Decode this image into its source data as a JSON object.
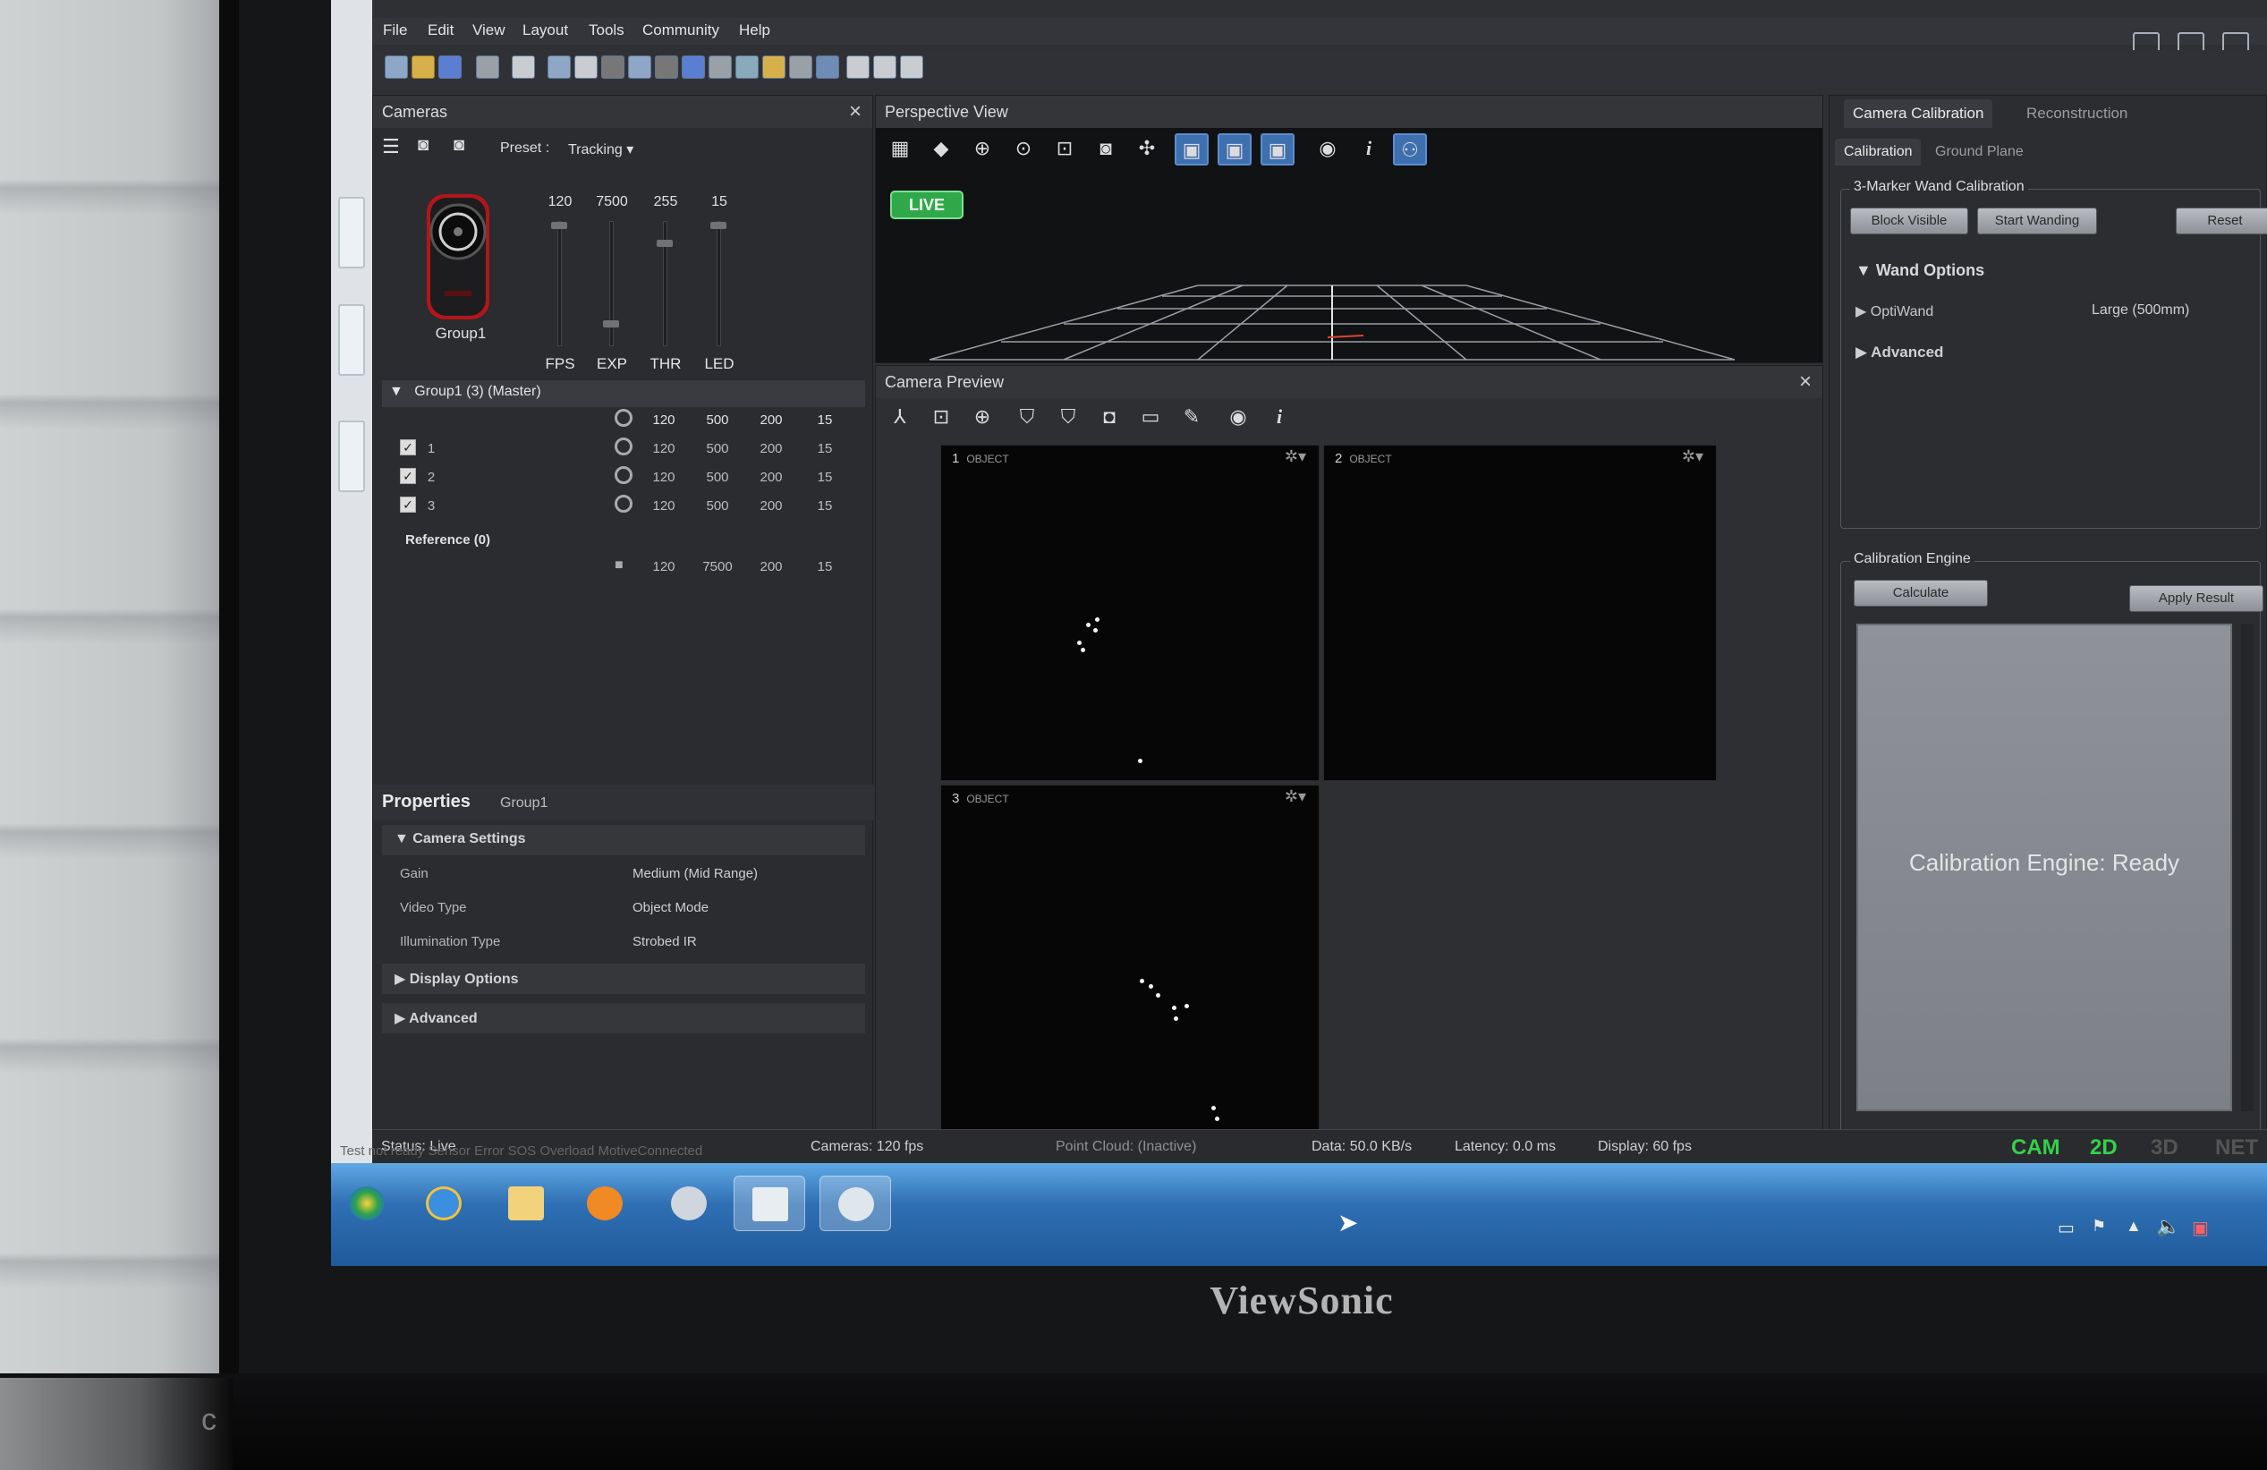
{
  "menu": [
    "File",
    "Edit",
    "View",
    "Layout",
    "Tools",
    "Community",
    "Help"
  ],
  "cameras": {
    "title": "Cameras",
    "preset_label": "Preset :",
    "preset_value": "Tracking",
    "camera_name": "Group1",
    "sliders": [
      {
        "label": "FPS",
        "value": "120"
      },
      {
        "label": "EXP",
        "value": "7500"
      },
      {
        "label": "THR",
        "value": "255"
      },
      {
        "label": "LED",
        "value": "15"
      }
    ],
    "group_row": {
      "label": "Group1 (3) (Master)",
      "fps": "120",
      "exp": "500",
      "thr": "200",
      "led": "15"
    },
    "rows": [
      {
        "id": "1",
        "fps": "120",
        "exp": "500",
        "thr": "200",
        "led": "15"
      },
      {
        "id": "2",
        "fps": "120",
        "exp": "500",
        "thr": "200",
        "led": "15"
      },
      {
        "id": "3",
        "fps": "120",
        "exp": "500",
        "thr": "200",
        "led": "15"
      }
    ],
    "reference": {
      "label": "Reference (0)",
      "fps": "120",
      "exp": "7500",
      "thr": "200",
      "led": "15"
    }
  },
  "properties": {
    "title": "Properties",
    "target": "Group1",
    "camera_settings": "Camera Settings",
    "rows": [
      {
        "name": "Gain",
        "value": "Medium (Mid Range)"
      },
      {
        "name": "Video Type",
        "value": "Object Mode"
      },
      {
        "name": "Illumination Type",
        "value": "Strobed IR"
      }
    ],
    "display_options": "Display Options",
    "advanced": "Advanced"
  },
  "perspective": {
    "title": "Perspective View",
    "live": "LIVE"
  },
  "preview": {
    "title": "Camera Preview",
    "viewports": [
      {
        "num": "1",
        "mode": "OBJECT"
      },
      {
        "num": "2",
        "mode": "OBJECT"
      },
      {
        "num": "3",
        "mode": "OBJECT"
      }
    ]
  },
  "right": {
    "tabs": [
      "Camera Calibration",
      "Reconstruction"
    ],
    "subtabs": [
      "Calibration",
      "Ground Plane"
    ],
    "wand_group": "3-Marker Wand Calibration",
    "buttons": {
      "block": "Block Visible",
      "start": "Start Wanding",
      "reset": "Reset",
      "calculate": "Calculate",
      "apply": "Apply Result"
    },
    "wand_options": "Wand Options",
    "optiwand": "OptiWand",
    "optiwand_value": "Large (500mm)",
    "advanced": "Advanced",
    "engine_group": "Calibration Engine",
    "engine_status": "Calibration Engine: Ready"
  },
  "status": {
    "status": "Status: Live",
    "cameras": "Cameras: 120 fps",
    "point_cloud": "Point Cloud: (Inactive)",
    "data": "Data: 50.0 KB/s",
    "latency": "Latency: 0.0 ms",
    "display": "Display: 60 fps",
    "indicators": [
      "CAM",
      "2D",
      "3D",
      "NET"
    ],
    "log_line": "Test not ready   Sensor Error   SOS   Overload   MotiveConnected"
  },
  "monitor_brand": "ViewSonic",
  "desk_mark": "c",
  "colors": {
    "accent_green": "#2fa84a",
    "indicator_green": "#33d24a",
    "active_blue": "#3e6fae"
  }
}
